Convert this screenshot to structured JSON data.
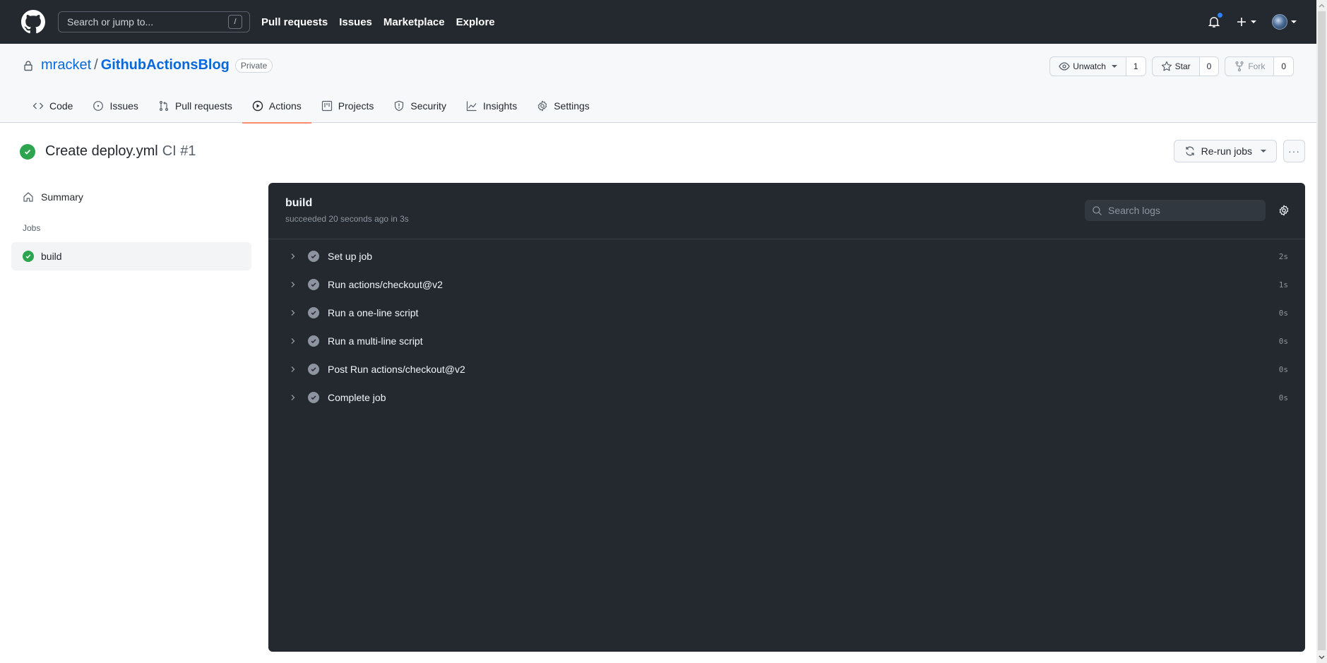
{
  "header": {
    "search_placeholder": "Search or jump to...",
    "search_shortcut": "/",
    "nav": [
      "Pull requests",
      "Issues",
      "Marketplace",
      "Explore"
    ],
    "notification_dot_color": "#2f81f7"
  },
  "repo": {
    "owner": "mracket",
    "separator": "/",
    "name": "GithubActionsBlog",
    "visibility": "Private",
    "watch": {
      "label": "Unwatch",
      "count": "1"
    },
    "star": {
      "label": "Star",
      "count": "0"
    },
    "fork": {
      "label": "Fork",
      "count": "0"
    }
  },
  "tabs": [
    {
      "label": "Code",
      "icon": "code-icon"
    },
    {
      "label": "Issues",
      "icon": "issue-icon"
    },
    {
      "label": "Pull requests",
      "icon": "pull-request-icon"
    },
    {
      "label": "Actions",
      "icon": "play-icon",
      "active": true
    },
    {
      "label": "Projects",
      "icon": "project-icon"
    },
    {
      "label": "Security",
      "icon": "shield-icon"
    },
    {
      "label": "Insights",
      "icon": "graph-icon"
    },
    {
      "label": "Settings",
      "icon": "gear-icon"
    }
  ],
  "run": {
    "title": "Create deploy.yml",
    "workflow": "CI #1",
    "status": "success",
    "rerun_label": "Re-run jobs",
    "more_label": "···"
  },
  "sidebar": {
    "summary_label": "Summary",
    "jobs_heading": "Jobs",
    "jobs": [
      {
        "label": "build",
        "status": "success"
      }
    ]
  },
  "log": {
    "job_name": "build",
    "status_text": "succeeded 20 seconds ago in 3s",
    "search_placeholder": "Search logs",
    "steps": [
      {
        "label": "Set up job",
        "duration": "2s"
      },
      {
        "label": "Run actions/checkout@v2",
        "duration": "1s"
      },
      {
        "label": "Run a one-line script",
        "duration": "0s"
      },
      {
        "label": "Run a multi-line script",
        "duration": "0s"
      },
      {
        "label": "Post Run actions/checkout@v2",
        "duration": "0s"
      },
      {
        "label": "Complete job",
        "duration": "0s"
      }
    ]
  },
  "colors": {
    "header_bg": "#24292f",
    "link": "#0969da",
    "success": "#2da44e",
    "active_tab_underline": "#fd8c73",
    "log_bg": "#24292f"
  }
}
